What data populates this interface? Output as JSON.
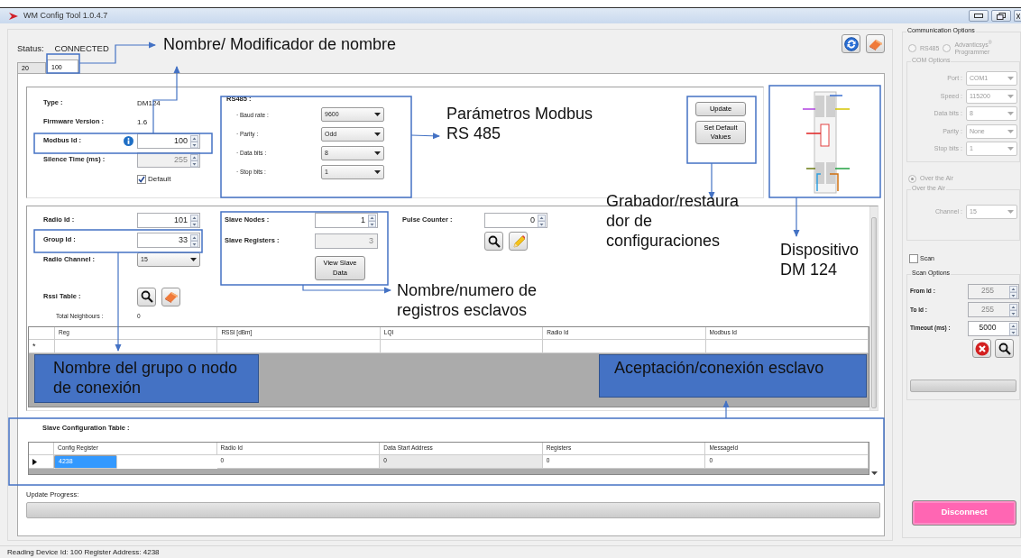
{
  "window": {
    "title": "WM Config Tool 1.0.4.7"
  },
  "status": {
    "label": "Status:",
    "value": "CONNECTED"
  },
  "tabs": [
    {
      "label": "20",
      "selected": false
    },
    {
      "label": "100",
      "selected": true
    }
  ],
  "device_info": {
    "fields": [
      {
        "kind": "text",
        "label": "Type :",
        "value": "DM124"
      },
      {
        "kind": "text",
        "label": "Firmware Version :",
        "value": "1.6"
      },
      {
        "kind": "spin",
        "label": "Modbus Id :",
        "value": "100",
        "info": true,
        "disabled": false
      },
      {
        "kind": "spin",
        "label": "Silence Time (ms) :",
        "value": "255",
        "disabled": true
      }
    ],
    "default_checkbox": {
      "label": "Default",
      "checked": true
    }
  },
  "rs485": {
    "title": "RS485 :",
    "fields": [
      {
        "label": "· Baud rate :",
        "value": "9600"
      },
      {
        "label": "· Parity :",
        "value": "Odd"
      },
      {
        "label": "· Data bits :",
        "value": "8"
      },
      {
        "label": "· Stop bits :",
        "value": "1"
      }
    ]
  },
  "config_buttons": [
    "Update",
    "Set Default Values"
  ],
  "radio": {
    "fields": [
      {
        "kind": "spin",
        "label": "Radio Id :",
        "value": "101"
      },
      {
        "kind": "spin",
        "label": "Group Id :",
        "value": "33"
      },
      {
        "kind": "select",
        "label": "Radio Channel :",
        "value": "15"
      }
    ],
    "rssi_label": "Rssi Table :",
    "neighbours": {
      "label": "Total Neighbours :",
      "value": "0"
    }
  },
  "slaves": {
    "fields": [
      {
        "kind": "spin",
        "label": "Slave Nodes :",
        "value": "1",
        "disabled": false
      },
      {
        "kind": "readonly",
        "label": "Slave Registers :",
        "value": "3",
        "disabled": true
      }
    ],
    "button": "View Slave Data"
  },
  "pulse_counter": {
    "label": "Pulse Counter :",
    "value": "0"
  },
  "rssi_table": {
    "columns": [
      "Reg",
      "RSSI [dBm]",
      "LQI",
      "Radio Id",
      "Modbus Id"
    ],
    "new_row_marker": "*"
  },
  "slave_table": {
    "title": "Slave Configuration Table :",
    "columns": [
      {
        "label": "Config Register",
        "readonly": false
      },
      {
        "label": "Radio Id",
        "readonly": false
      },
      {
        "label": "Data Start Address",
        "readonly": true
      },
      {
        "label": "Registers",
        "readonly": false
      },
      {
        "label": "MessageId",
        "readonly": false
      }
    ],
    "rows": [
      {
        "selected": true,
        "cells": [
          "4238",
          "0",
          "0",
          "0",
          "0"
        ]
      }
    ]
  },
  "update_progress": {
    "label": "Update Progress:",
    "level": 0
  },
  "status_bar": {
    "text": "Reading Device Id: 100 Register Address: 4238"
  },
  "communication": {
    "title": "Communication Options",
    "modes": [
      {
        "label": "RS485",
        "selected": false,
        "disabled": true
      },
      {
        "label": "Advanticsys$^{®}$ Programmer",
        "selected": false,
        "disabled": true
      },
      {
        "label": "Over the Air",
        "selected": true,
        "disabled": true
      }
    ],
    "com_options": {
      "title": "COM Options",
      "disabled": true,
      "fields": [
        {
          "label": "Port :",
          "value": "COM1"
        },
        {
          "label": "Speed :",
          "value": "115200"
        },
        {
          "label": "Data bits :",
          "value": "8"
        },
        {
          "label": "Parity :",
          "value": "None"
        },
        {
          "label": "Stop bits :",
          "value": "1"
        }
      ]
    },
    "ota_options": {
      "title": "Over the Air",
      "disabled": true,
      "fields": [
        {
          "label": "Channel :",
          "value": "15"
        }
      ]
    },
    "scan": {
      "label": "Scan",
      "checked": false
    },
    "scan_options": {
      "title": "Scan Options",
      "fields": [
        {
          "label": "From Id :",
          "value": "255",
          "disabled": true
        },
        {
          "label": "To Id :",
          "value": "255",
          "disabled": true
        },
        {
          "label": "Timeout (ms) :",
          "value": "5000",
          "disabled": false
        }
      ],
      "level": 0
    },
    "disconnect": "Disconnect"
  },
  "annotations": [
    {
      "kind": "plain",
      "text": "Nombre/ Modificador de nombre"
    },
    {
      "kind": "plain",
      "text": "Parámetros Modbus RS 485"
    },
    {
      "kind": "plain",
      "text": "Grabador/restaurador de configuraciones"
    },
    {
      "kind": "plain",
      "text": "Dispositivo DM 124"
    },
    {
      "kind": "plain",
      "text": "Nombre/numero de registros esclavos"
    },
    {
      "kind": "boxed",
      "text": "Nombre del grupo o nodo de conexión"
    },
    {
      "kind": "boxed",
      "text": "Aceptación/conexión esclavo"
    }
  ]
}
